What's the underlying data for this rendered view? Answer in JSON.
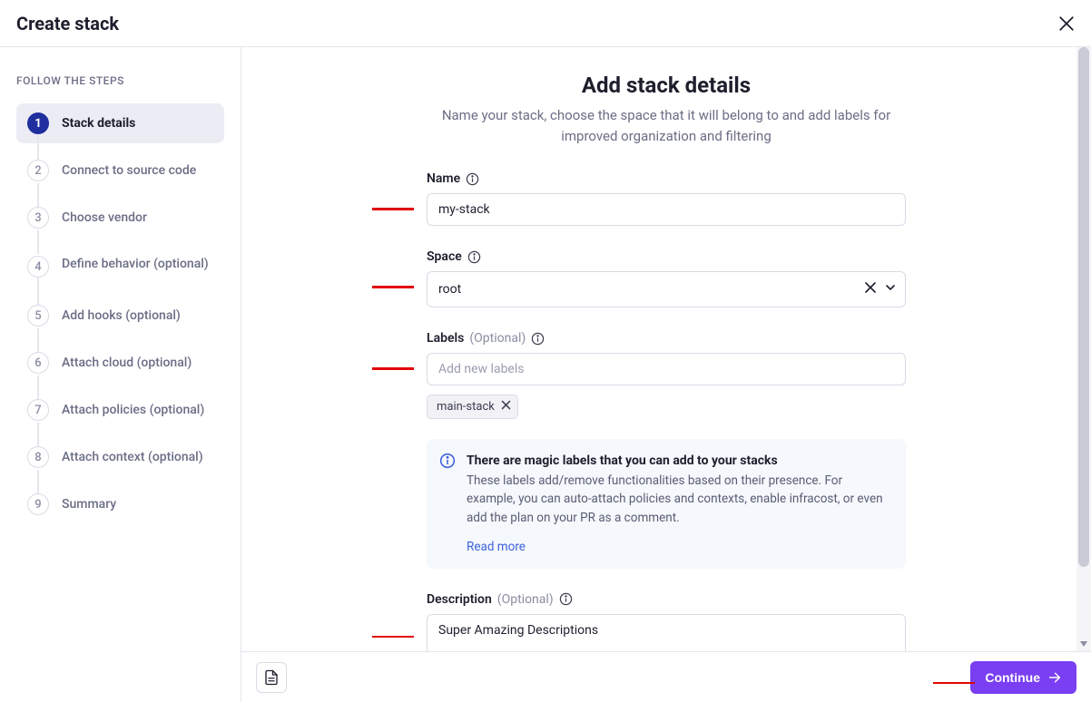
{
  "header": {
    "title": "Create stack"
  },
  "sidebar": {
    "heading": "FOLLOW THE STEPS",
    "steps": [
      {
        "num": "1",
        "label": "Stack details",
        "active": true
      },
      {
        "num": "2",
        "label": "Connect to source code",
        "active": false
      },
      {
        "num": "3",
        "label": "Choose vendor",
        "active": false
      },
      {
        "num": "4",
        "label": "Define behavior (optional)",
        "active": false
      },
      {
        "num": "5",
        "label": "Add hooks (optional)",
        "active": false
      },
      {
        "num": "6",
        "label": "Attach cloud (optional)",
        "active": false
      },
      {
        "num": "7",
        "label": "Attach policies (optional)",
        "active": false
      },
      {
        "num": "8",
        "label": "Attach context (optional)",
        "active": false
      },
      {
        "num": "9",
        "label": "Summary",
        "active": false
      }
    ]
  },
  "main": {
    "title": "Add stack details",
    "subtitle": "Name your stack, choose the space that it will belong to and add labels for improved organization and filtering",
    "name_label": "Name",
    "name_value": "my-stack",
    "space_label": "Space",
    "space_value": "root",
    "labels_label": "Labels",
    "labels_optional": "(Optional)",
    "labels_placeholder": "Add new labels",
    "labels_chips": [
      "main-stack"
    ],
    "infobox": {
      "title": "There are magic labels that you can add to your stacks",
      "text": "These labels add/remove functionalities based on their presence. For example, you can auto-attach policies and contexts, enable infracost, or even add the plan on your PR as a comment.",
      "link": "Read more"
    },
    "description_label": "Description",
    "description_optional": "(Optional)",
    "description_value": "Super Amazing Descriptions"
  },
  "footer": {
    "continue_label": "Continue"
  }
}
